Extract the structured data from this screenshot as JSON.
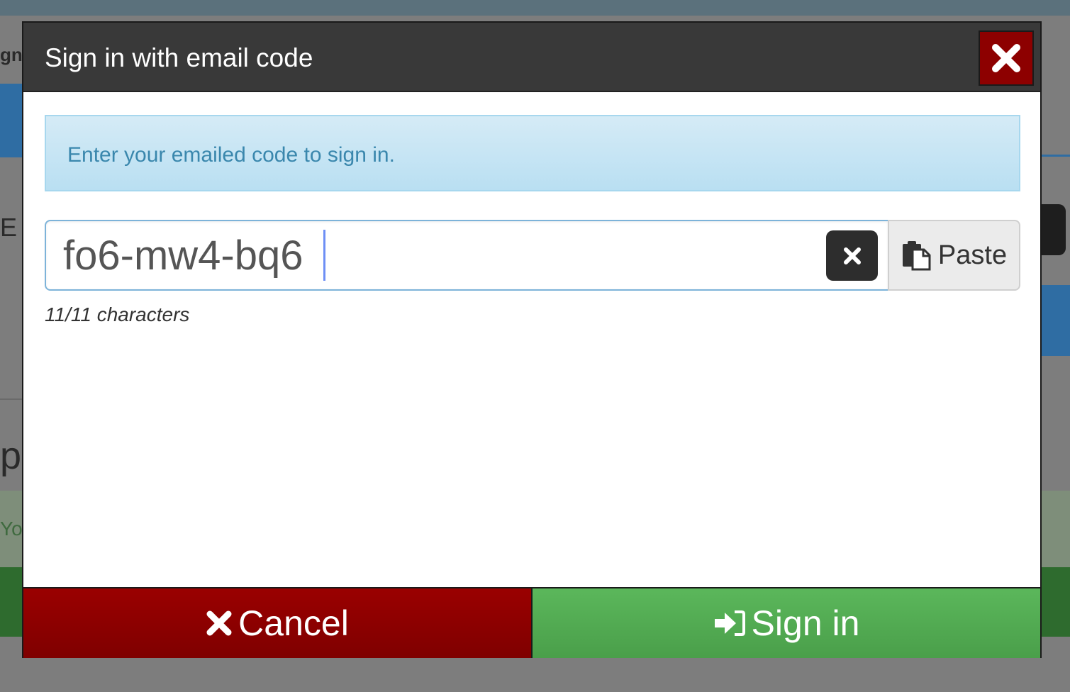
{
  "background": {
    "fragment_left_top": "gn",
    "fragment_left_mid": "E",
    "fragment_left_low": "p",
    "fragment_left_green": "Yo"
  },
  "dialog": {
    "title": "Sign in with email code",
    "info_message": "Enter your emailed code to sign in.",
    "code_input_value": "fo6-mw4-bq6",
    "paste_label": "Paste",
    "char_count": "11/11 characters",
    "cancel_label": "Cancel",
    "signin_label": "Sign in"
  },
  "colors": {
    "header_bg": "#393939",
    "close_bg": "#8d0000",
    "info_bg": "#c7e5f4",
    "info_text": "#3a87ad",
    "cancel_bg": "#8c0000",
    "signin_bg": "#52ab52"
  },
  "icons": {
    "close": "close-icon",
    "clear": "clear-icon",
    "paste": "clipboard-icon",
    "cancel": "x-icon",
    "signin": "sign-in-icon"
  }
}
